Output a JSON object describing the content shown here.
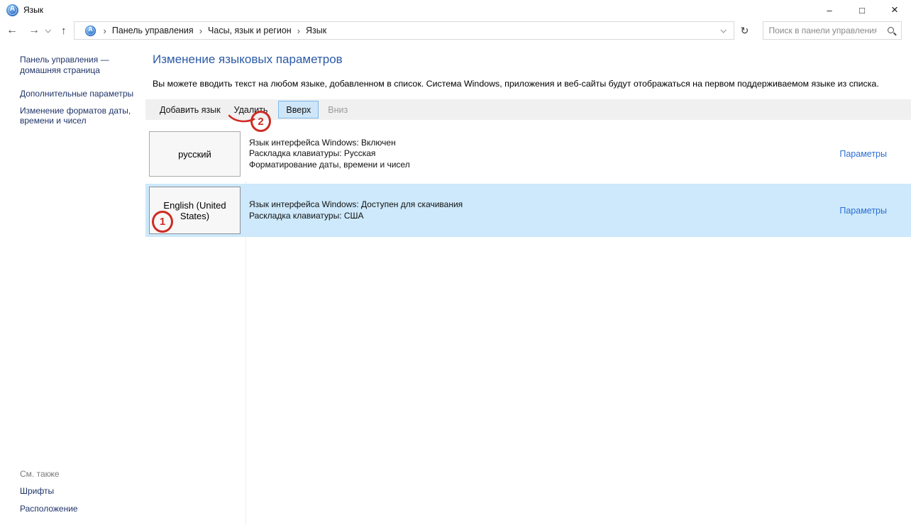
{
  "window": {
    "title": "Язык"
  },
  "icons": {
    "app": "language-globe",
    "back": "←",
    "forward": "→",
    "up": "↑",
    "refresh": "↻",
    "minimize": "–",
    "maximize": "□",
    "close": "×",
    "breadcrumb_separator": "›"
  },
  "navigation": {
    "breadcrumb": {
      "items": [
        "Панель управления",
        "Часы, язык и регион",
        "Язык"
      ]
    },
    "search": {
      "placeholder": "Поиск в панели управления"
    }
  },
  "sidebar": {
    "items": [
      {
        "label": "Панель управления — домашняя страница"
      },
      {
        "label": "Дополнительные параметры"
      },
      {
        "label": "Изменение форматов даты, времени и чисел"
      }
    ],
    "see_also": {
      "header": "См. также",
      "items": [
        {
          "label": "Шрифты"
        },
        {
          "label": "Расположение"
        }
      ]
    }
  },
  "main": {
    "heading": "Изменение языковых параметров",
    "description": "Вы можете вводить текст на любом языке, добавленном в список. Система Windows, приложения и веб-сайты будут отображаться на первом поддерживаемом языке из списка.",
    "toolbar": {
      "add_language": "Добавить язык",
      "remove": "Удалить",
      "move_up": "Вверх",
      "move_down": "Вниз"
    },
    "languages": [
      {
        "name": "русский",
        "details": [
          "Язык интерфейса Windows: Включен",
          "Раскладка клавиатуры: Русская",
          "Форматирование даты, времени и чисел"
        ],
        "options_label": "Параметры",
        "selected": false
      },
      {
        "name": "English (United States)",
        "details": [
          "Язык интерфейса Windows: Доступен для скачивания",
          "Раскладка клавиатуры: США"
        ],
        "options_label": "Параметры",
        "selected": true
      }
    ]
  },
  "annotations": [
    {
      "label": "1"
    },
    {
      "label": "2"
    }
  ],
  "colors": {
    "selection_bg": "#cde9fb",
    "annotation_red": "#ce2b24",
    "link_blue": "#2b6fd4",
    "heading_blue": "#2b5aa7",
    "sidebar_link": "#1f3469",
    "toolbar_bg": "#f0f0f0",
    "up_button_bg": "#cfe6f8",
    "up_button_border": "#7cb8ec"
  }
}
